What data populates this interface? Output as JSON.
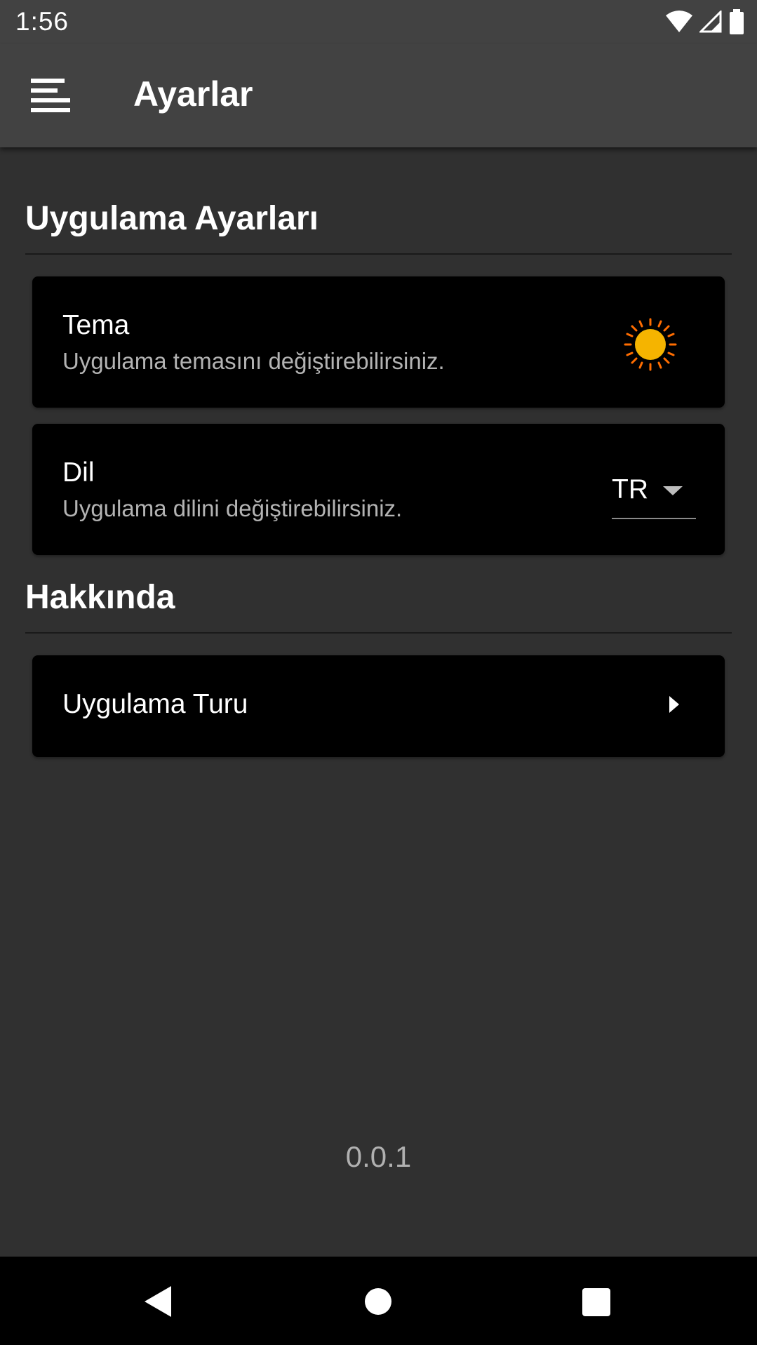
{
  "status_bar": {
    "time": "1:56",
    "icons": [
      "wifi-icon",
      "cellular-signal-icon",
      "battery-icon"
    ]
  },
  "app_bar": {
    "menu_icon": "menu-icon",
    "title": "Ayarlar"
  },
  "sections": {
    "app_settings": {
      "title": "Uygulama Ayarları",
      "theme": {
        "title": "Tema",
        "subtitle": "Uygulama temasını değiştirebilirsiniz.",
        "icon": "sun-icon"
      },
      "language": {
        "title": "Dil",
        "subtitle": "Uygulama dilini değiştirebilirsiniz.",
        "selected": "TR"
      }
    },
    "about": {
      "title": "Hakkında",
      "tour": {
        "title": "Uygulama Turu",
        "icon": "chevron-right-icon"
      }
    }
  },
  "version": "0.0.1",
  "nav_bar": {
    "icons": [
      "back-icon",
      "home-icon",
      "recents-icon"
    ]
  },
  "colors": {
    "background": "#303030",
    "app_bar": "#424242",
    "card": "#000000",
    "sun_core": "#f5b400",
    "sun_rays": "#ff6d00"
  }
}
